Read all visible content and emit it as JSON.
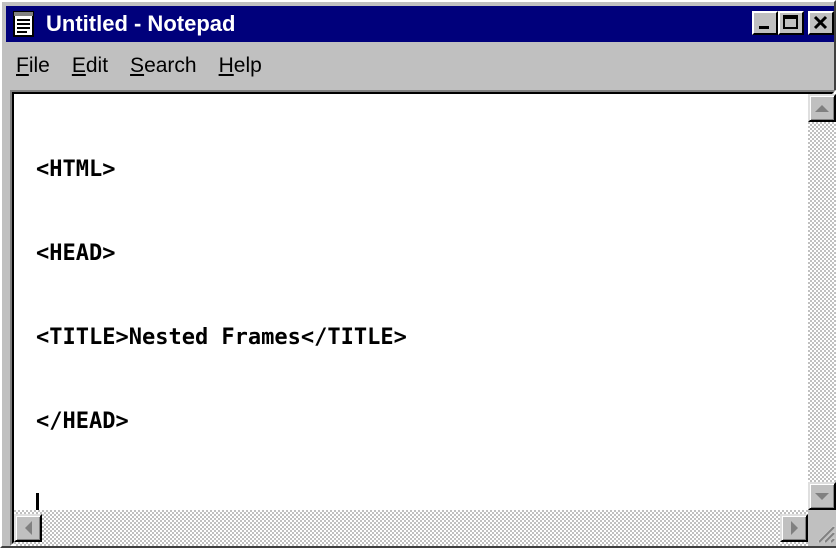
{
  "window": {
    "title": "Untitled - Notepad",
    "app_icon": "notepad-icon",
    "buttons": [
      "minimize-icon",
      "maximize-icon",
      "close-icon"
    ]
  },
  "menu": {
    "items": [
      {
        "mnemonic": "F",
        "rest": "ile"
      },
      {
        "mnemonic": "E",
        "rest": "dit"
      },
      {
        "mnemonic": "S",
        "rest": "earch"
      },
      {
        "mnemonic": "H",
        "rest": "elp"
      }
    ]
  },
  "editor": {
    "lines": [
      "<HTML>",
      "<HEAD>",
      "<TITLE>Nested Frames</TITLE>",
      "</HEAD>"
    ]
  },
  "colors": {
    "titlebar": "#00007b",
    "chrome": "#c0c0c0",
    "text_background": "#ffffff"
  }
}
